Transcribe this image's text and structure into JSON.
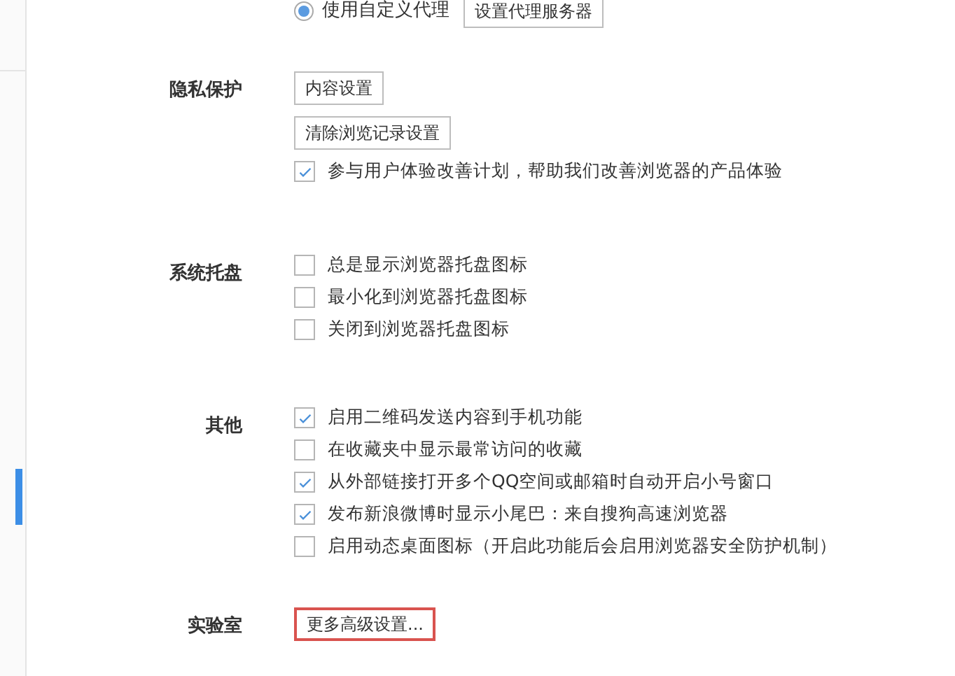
{
  "proxy": {
    "radio": {
      "label": "使用自定义代理",
      "selected": true
    },
    "button": "设置代理服务器"
  },
  "sections": [
    {
      "title": "隐私保护",
      "items": [
        {
          "kind": "button",
          "label": "内容设置",
          "highlighted": false
        },
        {
          "kind": "button",
          "label": "清除浏览记录设置",
          "highlighted": false
        },
        {
          "kind": "checkbox",
          "label": "参与用户体验改善计划，帮助我们改善浏览器的产品体验",
          "checked": true
        }
      ]
    },
    {
      "title": "系统托盘",
      "items": [
        {
          "kind": "checkbox",
          "label": "总是显示浏览器托盘图标",
          "checked": false
        },
        {
          "kind": "checkbox",
          "label": "最小化到浏览器托盘图标",
          "checked": false
        },
        {
          "kind": "checkbox",
          "label": "关闭到浏览器托盘图标",
          "checked": false
        }
      ]
    },
    {
      "title": "其他",
      "items": [
        {
          "kind": "checkbox",
          "label": "启用二维码发送内容到手机功能",
          "checked": true
        },
        {
          "kind": "checkbox",
          "label": "在收藏夹中显示最常访问的收藏",
          "checked": false
        },
        {
          "kind": "checkbox",
          "label": "从外部链接打开多个QQ空间或邮箱时自动开启小号窗口",
          "checked": true
        },
        {
          "kind": "checkbox",
          "label": "发布新浪微博时显示小尾巴：来自搜狗高速浏览器",
          "checked": true
        },
        {
          "kind": "checkbox",
          "label": "启用动态桌面图标（开启此功能后会启用浏览器安全防护机制）",
          "checked": false
        }
      ]
    },
    {
      "title": "实验室",
      "items": [
        {
          "kind": "button",
          "label": "更多高级设置...",
          "highlighted": true
        }
      ]
    }
  ]
}
